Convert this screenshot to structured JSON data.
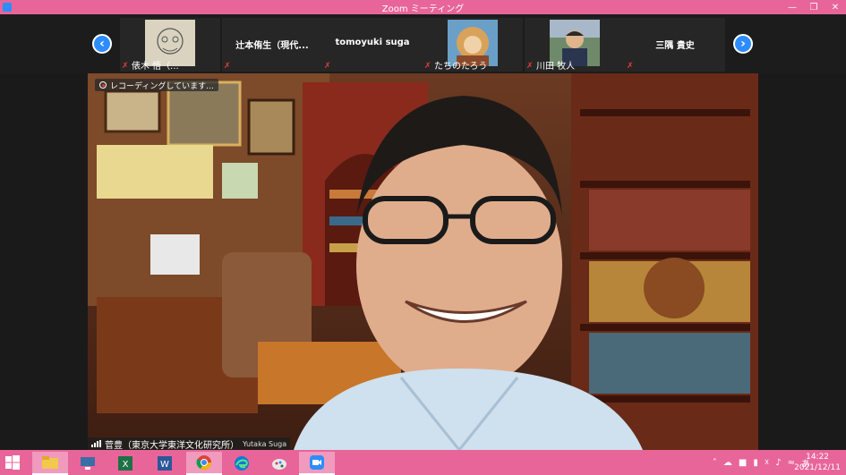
{
  "window": {
    "title": "Zoom ミーティング",
    "controls": [
      "minimize-icon",
      "restore-icon",
      "close-icon"
    ]
  },
  "strip": {
    "tiles": [
      {
        "name": "俵木 悟（...",
        "has_photo": true,
        "muted": true
      },
      {
        "name": "辻本侑生（現代...",
        "has_photo": false,
        "muted": true
      },
      {
        "name": "tomoyuki suga",
        "has_photo": false,
        "muted": true
      },
      {
        "name": "たちのたろう",
        "has_photo": true,
        "muted": true
      },
      {
        "name": "川田 牧人",
        "has_photo": true,
        "muted": true
      },
      {
        "name": "三隅 貴史",
        "has_photo": false,
        "muted": true
      }
    ]
  },
  "video": {
    "recording_label": "レコーディングしています...",
    "speaker_name": "菅豊（東京大学東洋文化研究所）",
    "speaker_alt": "Yutaka Suga"
  },
  "taskbar": {
    "apps": [
      {
        "name": "file-explorer",
        "active": true
      },
      {
        "name": "network-icon-app",
        "active": false
      },
      {
        "name": "excel",
        "active": false
      },
      {
        "name": "word",
        "active": false
      },
      {
        "name": "chrome",
        "active": true
      },
      {
        "name": "edge",
        "active": false
      },
      {
        "name": "paint",
        "active": false
      },
      {
        "name": "zoom",
        "active": true
      }
    ],
    "time": "14:22",
    "date": "2021/12/11",
    "ime": "あ"
  },
  "colors": {
    "accent": "#e8659a",
    "zoom_blue": "#2d8cff",
    "muted_red": "#e23b3b"
  }
}
